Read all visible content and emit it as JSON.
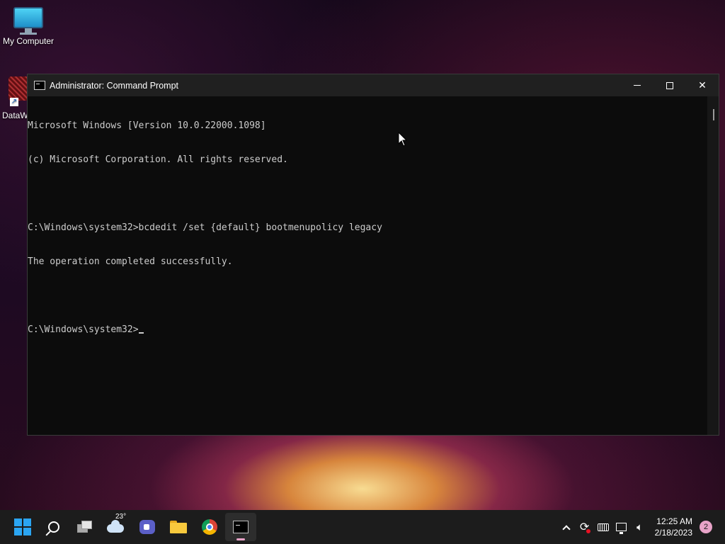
{
  "desktop": {
    "icons": [
      {
        "label": "My Computer",
        "icon": "monitor-icon"
      },
      {
        "label": "DataW",
        "icon": "datawarehouse-shortcut-icon"
      }
    ]
  },
  "window": {
    "title": "Administrator: Command Prompt",
    "icon": "cmd-icon",
    "controls": {
      "minimize": "minimize-icon",
      "maximize": "maximize-icon",
      "close": "close-icon"
    },
    "console_lines": [
      "Microsoft Windows [Version 10.0.22000.1098]",
      "(c) Microsoft Corporation. All rights reserved.",
      "",
      "C:\\Windows\\system32>bcdedit /set {default} bootmenupolicy legacy",
      "The operation completed successfully.",
      "",
      "C:\\Windows\\system32>"
    ]
  },
  "taskbar": {
    "apps": [
      {
        "name": "start",
        "icon": "windows-logo-icon"
      },
      {
        "name": "search",
        "icon": "search-icon"
      },
      {
        "name": "task-view",
        "icon": "task-view-icon"
      },
      {
        "name": "weather",
        "icon": "cloud-icon",
        "temp": "23°"
      },
      {
        "name": "teams-chat",
        "icon": "meet-icon"
      },
      {
        "name": "file-explorer",
        "icon": "folder-icon"
      },
      {
        "name": "chrome",
        "icon": "chrome-icon"
      },
      {
        "name": "command-prompt",
        "icon": "cmd-icon",
        "active": true
      }
    ],
    "tray": {
      "time": "12:25 AM",
      "date": "2/18/2023",
      "notification_count": "2"
    }
  },
  "colors": {
    "console_bg": "#0c0c0c",
    "console_text": "#cccccc",
    "titlebar": "#202020",
    "taskbar": "#1c1c1c",
    "accent": "#2ba5f2",
    "notif_badge": "#e8a3c8"
  }
}
